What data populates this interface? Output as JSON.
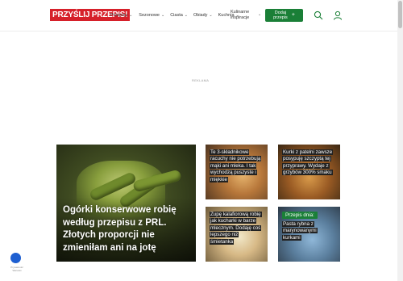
{
  "header": {
    "logo": "PRZYŚLIJ PRZEPIS!",
    "nav": [
      {
        "label": "Przepisy"
      },
      {
        "label": "Sezonowe"
      },
      {
        "label": "Ciasta"
      },
      {
        "label": "Obiady"
      },
      {
        "label": "Kuchnia"
      }
    ],
    "inspiration_line1": "Kulinarne",
    "inspiration_line2": "inspiracje",
    "add_recipe_line1": "Dodaj",
    "add_recipe_line2": "przepis",
    "add_recipe_plus": "+",
    "chevron": "⌄",
    "icons": {
      "search": "search-icon",
      "user": "user-icon"
    }
  },
  "ad_label": "REKLAMA",
  "featured": {
    "title": "Ogórki konserwowe robię według przepisu z PRL. Złotych proporcji nie zmieniłam ani na jotę"
  },
  "cards": [
    {
      "title": "Te 3-składnikowe racuchy nie potrzebują mąki ani mleka. I tak wychodzą puszyste i miękkie"
    },
    {
      "title": "Kurki z patelni zawsze posypuję szczyptą tej przyprawy. Wydaje z grzybów 300% smaku"
    },
    {
      "title": "Zupę kalafiorową robię jak kucharki w barze mlecznym. Dodaję coś lepszego niż śmietanka"
    },
    {
      "badge": "Przepis dnia:",
      "title": "Pasta rybna z marynowanymi kurkami"
    }
  ],
  "privacy": {
    "line1": "Prywatność",
    "line2": "Warunki"
  },
  "colors": {
    "brand": "#d6202a",
    "accent": "#1a7f37"
  }
}
